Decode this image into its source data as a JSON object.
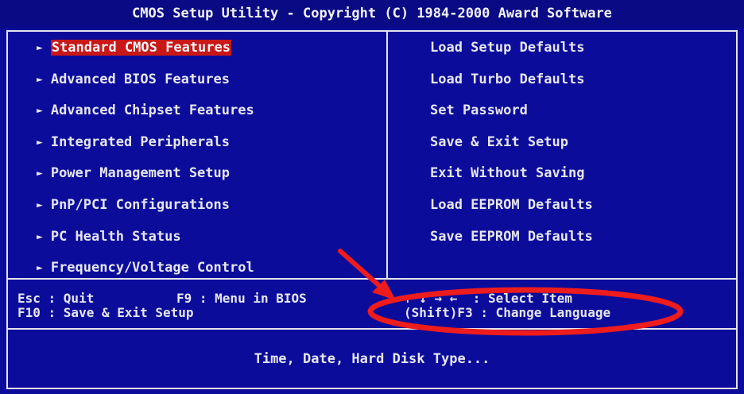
{
  "title": "CMOS Setup Utility - Copyright (C) 1984-2000 Award Software",
  "left_menu": [
    {
      "label": "Standard CMOS Features",
      "selected": true
    },
    {
      "label": "Advanced BIOS Features",
      "selected": false
    },
    {
      "label": "Advanced Chipset Features",
      "selected": false
    },
    {
      "label": "Integrated Peripherals",
      "selected": false
    },
    {
      "label": "Power Management Setup",
      "selected": false
    },
    {
      "label": "PnP/PCI Configurations",
      "selected": false
    },
    {
      "label": "PC Health Status",
      "selected": false
    },
    {
      "label": "Frequency/Voltage Control",
      "selected": false
    }
  ],
  "right_menu": [
    {
      "label": "Load Setup Defaults"
    },
    {
      "label": "Load Turbo Defaults"
    },
    {
      "label": "Set Password"
    },
    {
      "label": "Save & Exit Setup"
    },
    {
      "label": "Exit Without Saving"
    },
    {
      "label": "Load EEPROM Defaults"
    },
    {
      "label": "Save EEPROM Defaults"
    }
  ],
  "menu_arrow_glyph": "►",
  "key_help": {
    "esc": "Esc : Quit",
    "f9": "F9 : Menu in BIOS",
    "f10": "F10 : Save & Exit Setup",
    "select_item": "↑ ↓ → ←  : Select Item",
    "change_language": "(Shift)F3 : Change Language"
  },
  "status_text": "Time, Date, Hard Disk Type...",
  "colors": {
    "background": "#0c0c9a",
    "title_bar": "#0a0a84",
    "highlight": "#c81818",
    "text": "#e6e6f2",
    "annotation": "#ee1c1c"
  },
  "annotation": {
    "arrow_icon": "red-arrow-icon",
    "ellipse_icon": "red-ellipse-icon"
  }
}
